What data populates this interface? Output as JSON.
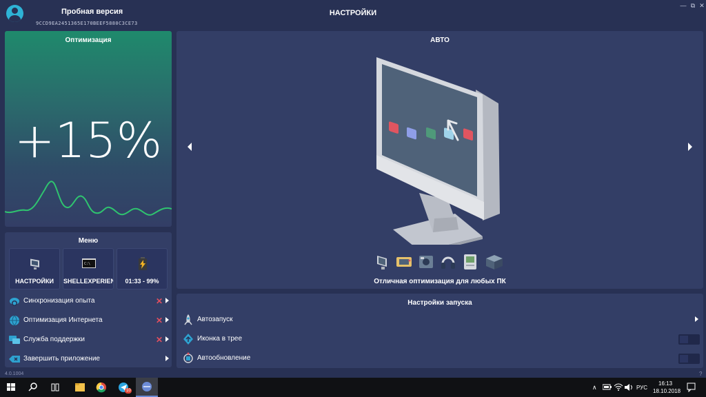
{
  "titlebar": {
    "trial_label": "Пробная версия",
    "hwid": "9CCD9EA2451365E170BEEF5880C3CE73",
    "page_title": "НАСТРОЙКИ",
    "minimize": "—",
    "restore": "⧉",
    "close": "✕"
  },
  "optimization": {
    "title": "Оптимизация",
    "value": "+15%",
    "accent": "#2fc46f"
  },
  "menu": {
    "title": "Меню",
    "tiles": [
      {
        "label": "НАСТРОЙКИ",
        "icon": "monitor-icon"
      },
      {
        "label": "SHELLEXPERIEN",
        "icon": "terminal-icon"
      },
      {
        "label": "01:33 - 99%",
        "icon": "battery-icon"
      }
    ],
    "items": [
      {
        "label": "Синхронизация опыта",
        "icon": "cloud-sync-icon",
        "status": "✕"
      },
      {
        "label": "Оптимизация Интернета",
        "icon": "globe-icon",
        "status": "✕"
      },
      {
        "label": "Служба поддержки",
        "icon": "chat-icon",
        "status": "✕"
      },
      {
        "label": "Завершить приложение",
        "icon": "exit-icon"
      }
    ]
  },
  "auto": {
    "title": "АВТО",
    "caption": "Отличная оптимизация для любых ПК",
    "modes": [
      "pc-icon",
      "gamepad-icon",
      "media-icon",
      "headphones-icon",
      "retro-pc-icon",
      "server-icon"
    ]
  },
  "launch": {
    "title": "Настройки запуска",
    "items": [
      {
        "label": "Автозапуск",
        "icon": "rocket-icon",
        "control": "arrow"
      },
      {
        "label": "Иконка в трее",
        "icon": "tray-icon",
        "control": "toggle",
        "on": false
      },
      {
        "label": "Автообновление",
        "icon": "update-icon",
        "control": "toggle",
        "on": false
      }
    ]
  },
  "footer": {
    "version": "4.0.1004",
    "help": "?"
  },
  "taskbar": {
    "language": "РУС",
    "time": "16:13",
    "date": "18.10.2018",
    "telegram_badge": "10"
  }
}
